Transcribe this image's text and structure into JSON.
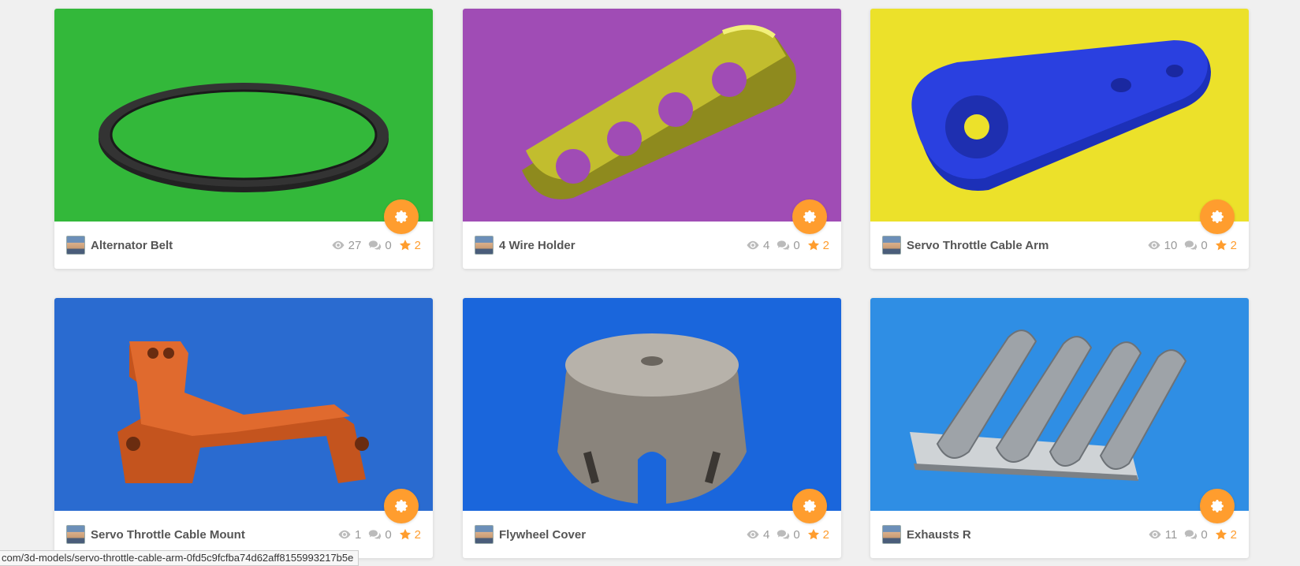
{
  "colors": {
    "accent": "#ff9d2e",
    "card_bg": "#ffffff",
    "page_bg": "#f0f0f0"
  },
  "cards": [
    {
      "title": "Alternator Belt",
      "views": "27",
      "comments": "0",
      "likes": "2",
      "bg": "#33b83a",
      "icon": "settings-icon"
    },
    {
      "title": "4 Wire Holder",
      "views": "4",
      "comments": "0",
      "likes": "2",
      "bg": "#a04cb5",
      "icon": "settings-icon"
    },
    {
      "title": "Servo Throttle Cable Arm",
      "views": "10",
      "comments": "0",
      "likes": "2",
      "bg": "#ece12a",
      "icon": "settings-icon"
    },
    {
      "title": "Servo Throttle Cable Mount",
      "views": "1",
      "comments": "0",
      "likes": "2",
      "bg": "#2a6bd0",
      "icon": "settings-icon"
    },
    {
      "title": "Flywheel Cover",
      "views": "4",
      "comments": "0",
      "likes": "2",
      "bg": "#1a66dc",
      "icon": "settings-icon"
    },
    {
      "title": "Exhausts R",
      "views": "11",
      "comments": "0",
      "likes": "2",
      "bg": "#2f8ee4",
      "icon": "settings-icon"
    }
  ],
  "status_bar": {
    "url": "com/3d-models/servo-throttle-cable-arm-0fd5c9fcfba74d62aff8155993217b5e"
  }
}
